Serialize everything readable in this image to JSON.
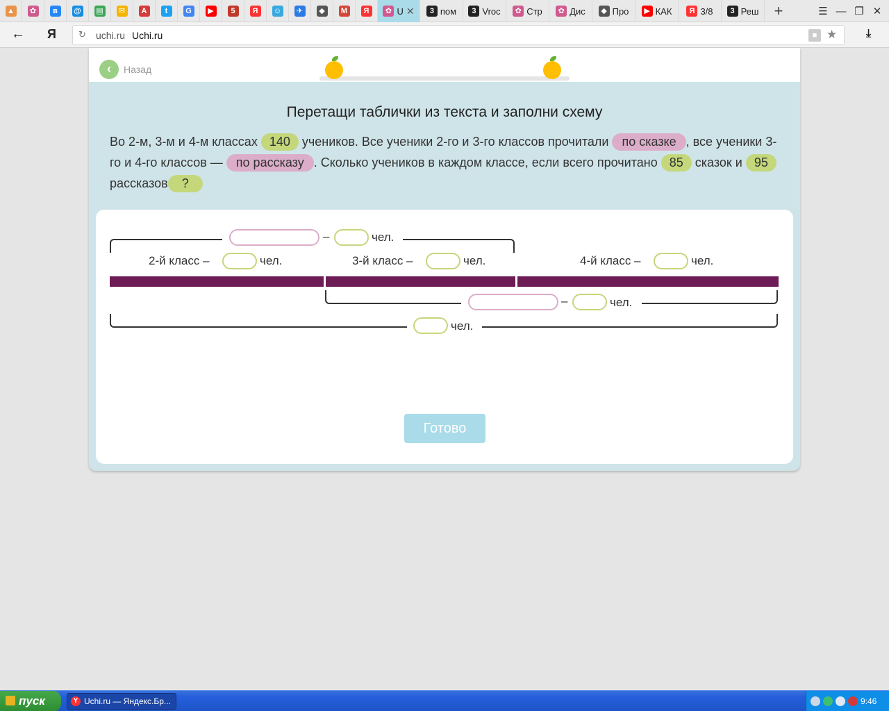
{
  "browser": {
    "tabs": [
      {
        "title": "",
        "icon": "picture-icon",
        "color": "#e9944a",
        "active": false
      },
      {
        "title": "",
        "icon": "uchi-icon",
        "color": "#d05a8f",
        "active": false
      },
      {
        "title": "",
        "icon": "vk-icon",
        "color": "#2787f5",
        "active": false
      },
      {
        "title": "",
        "icon": "mail-at-icon",
        "color": "#168de2",
        "active": false
      },
      {
        "title": "",
        "icon": "school-icon",
        "color": "#3aa757",
        "active": false
      },
      {
        "title": "",
        "icon": "envelope-icon",
        "color": "#f5b400",
        "active": false
      },
      {
        "title": "",
        "icon": "abc-icon",
        "color": "#d83a3a",
        "active": false
      },
      {
        "title": "",
        "icon": "twitter-icon",
        "color": "#1da1f2",
        "active": false
      },
      {
        "title": "",
        "icon": "google-icon",
        "color": "#4285f4",
        "active": false
      },
      {
        "title": "",
        "icon": "youtube-icon",
        "color": "#ff0000",
        "active": false
      },
      {
        "title": "",
        "icon": "badge-562-icon",
        "color": "#c0392b",
        "active": false
      },
      {
        "title": "",
        "icon": "yandex-icon",
        "color": "#ff3333",
        "active": false
      },
      {
        "title": "",
        "icon": "face-icon",
        "color": "#39a9e0",
        "active": false
      },
      {
        "title": "",
        "icon": "plane-icon",
        "color": "#2c7be5",
        "active": false
      },
      {
        "title": "",
        "icon": "roblox-icon",
        "color": "#555555",
        "active": false
      },
      {
        "title": "",
        "icon": "gmail-icon",
        "color": "#d44638",
        "active": false
      },
      {
        "title": "",
        "icon": "yandex-icon",
        "color": "#ff3333",
        "active": false
      },
      {
        "title": "U",
        "icon": "uchi-icon",
        "color": "#d05a8f",
        "active": true
      },
      {
        "title": "пом",
        "icon": "digit3-icon",
        "color": "#222222",
        "active": false
      },
      {
        "title": "Vroc",
        "icon": "digit3-icon",
        "color": "#222222",
        "active": false
      },
      {
        "title": "Стр",
        "icon": "uchi-icon",
        "color": "#d05a8f",
        "active": false
      },
      {
        "title": "Дис",
        "icon": "uchi-icon",
        "color": "#d05a8f",
        "active": false
      },
      {
        "title": "Про",
        "icon": "roblox-icon",
        "color": "#555555",
        "active": false
      },
      {
        "title": "КАК",
        "icon": "youtube-icon",
        "color": "#ff0000",
        "active": false
      },
      {
        "title": "3/8",
        "icon": "yandex-icon",
        "color": "#ff3333",
        "active": false
      },
      {
        "title": "Реш",
        "icon": "digit3-icon",
        "color": "#222222",
        "active": false
      }
    ],
    "new_tab": "+",
    "url_domain": "uchi.ru",
    "url_title": "Uchi.ru",
    "logo_text": "Я"
  },
  "page": {
    "back_label": "Назад",
    "title": "Перетащи таблички из текста и заполни схему",
    "problem": {
      "t1": "Во 2-м, 3-м и 4-м классах ",
      "chip1": "140",
      "t2": " учеников. Все ученики 2-го и 3-го классов прочитали ",
      "chip2": "по сказке",
      "t3": ", все ученики 3-го и 4-го классов — ",
      "chip3": "по рассказу",
      "t4": ". Сколько учеников в каждом классе, если всего прочитано ",
      "chip4": "85",
      "t5": " сказок и ",
      "chip5": "95",
      "t6": " рассказов",
      "chip6": "?"
    },
    "scheme": {
      "dash": "–",
      "unit": "чел.",
      "class2": "2-й класс –",
      "class3": "3-й класс –",
      "class4": "4-й класс –"
    },
    "ready_label": "Готово"
  },
  "taskbar": {
    "start_label": "пуск",
    "task_label": "Uchi.ru — Яндекс.Бр...",
    "clock": "9:46"
  },
  "colors": {
    "accent_green": "#c4d77a",
    "accent_pink": "#dcadc9",
    "bar_purple": "#6d1c56",
    "ready_button": "#a9dbe9",
    "card_bg": "#cfe4e9"
  }
}
